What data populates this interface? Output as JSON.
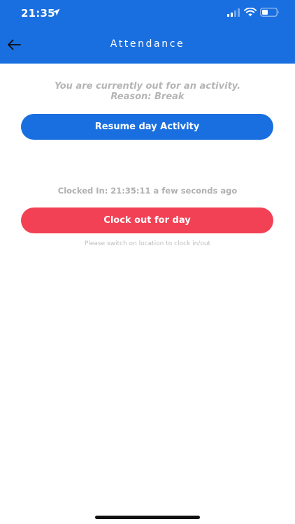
{
  "status_bar": {
    "time": "21:35"
  },
  "header": {
    "title": "Attendance",
    "back_icon": "arrow-left-icon"
  },
  "activity_status": {
    "line1": "You are currently out for an activity.",
    "line2": "Reason: Break"
  },
  "resume_button": {
    "label": "Resume day Activity"
  },
  "clocked_in": {
    "text": "Clocked In: 21:35:11 a few seconds ago"
  },
  "clock_out_button": {
    "label": "Clock out for day"
  },
  "location_note": {
    "text": "Please switch on location to clock in/out"
  },
  "colors": {
    "primary": "#1a6fe0",
    "danger": "#f24155",
    "muted_text": "#b5b5b5"
  }
}
